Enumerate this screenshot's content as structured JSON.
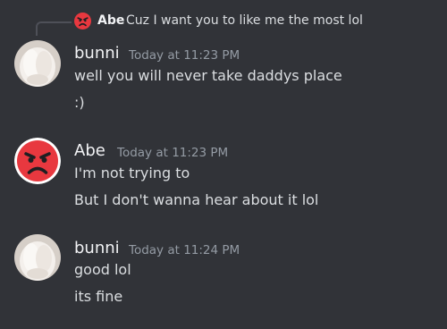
{
  "reply": {
    "author": "Abe",
    "text": "Cuz I want you to like me the most lol",
    "avatar_icon": "angry-face-icon"
  },
  "messages": [
    {
      "author": "bunni",
      "timestamp": "Today at 11:23 PM",
      "avatar_icon": "fluffy-white-avatar",
      "lines": [
        "well you will never take daddys place",
        ":)"
      ]
    },
    {
      "author": "Abe",
      "timestamp": "Today at 11:23 PM",
      "avatar_icon": "angry-face-icon",
      "lines": [
        "I'm not trying to",
        "But I don't wanna hear about it lol"
      ]
    },
    {
      "author": "bunni",
      "timestamp": "Today at 11:24 PM",
      "avatar_icon": "fluffy-white-avatar",
      "lines": [
        "good lol",
        "its fine"
      ]
    }
  ],
  "colors": {
    "background": "#313338",
    "username": "#f2f3f5",
    "text": "#dbdee1",
    "timestamp": "#949ba4",
    "angry_red": "#e8383f"
  }
}
